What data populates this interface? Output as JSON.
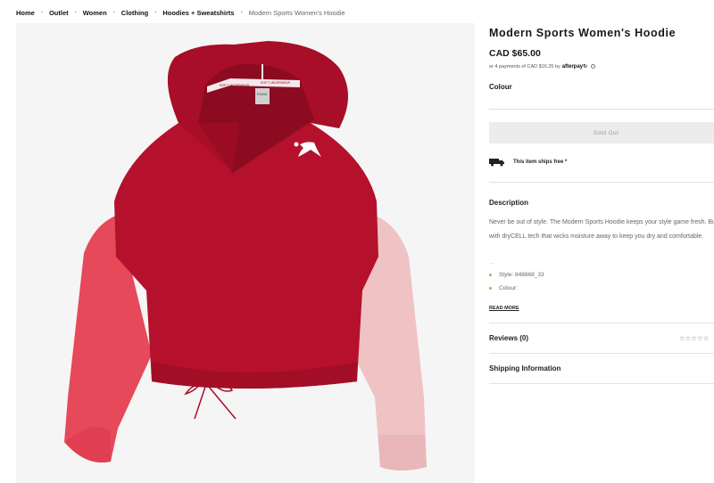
{
  "breadcrumb": {
    "items": [
      "Home",
      "Outlet",
      "Women",
      "Clothing",
      "Hoodies + Sweatshirts"
    ],
    "current": "Modern Sports Women's Hoodie",
    "separator": "•"
  },
  "product": {
    "title": "Modern Sports Women's Hoodie",
    "price": "CAD $65.00",
    "afterpay_text": "or 4 payments of CAD $16.25 by",
    "afterpay_brand": "afterpay↻",
    "colour_label": "Colour",
    "sold_out_label": "Sold Out",
    "shipping_note": "This item ships free *"
  },
  "description": {
    "heading": "Description",
    "toggle": "–",
    "text": "Never be out of style. The Modern Sports Hoodie keeps your style game fresh. Built with dryCELL tech that wicks moisture away to keep you dry and comfortable.",
    "dots": "...",
    "bullets": [
      "Style: 848868_33",
      "Colour:"
    ],
    "read_more": "READ MORE"
  },
  "reviews": {
    "heading": "Reviews (0)",
    "stars": "☆☆☆☆☆",
    "toggle": "▴"
  },
  "shipping_info": {
    "heading": "Shipping Information",
    "toggle": "▴"
  },
  "image": {
    "label_text": "SOFT UNDERWEAR",
    "tag_brand": "PUMA"
  },
  "colors": {
    "body_red": "#b5112c",
    "hood_red": "#a80e27",
    "left_sleeve": "#e64959",
    "right_sleeve": "#efc2c4",
    "gallery_bg": "#f5f5f6",
    "afterpay_dot": "#c6a357"
  }
}
